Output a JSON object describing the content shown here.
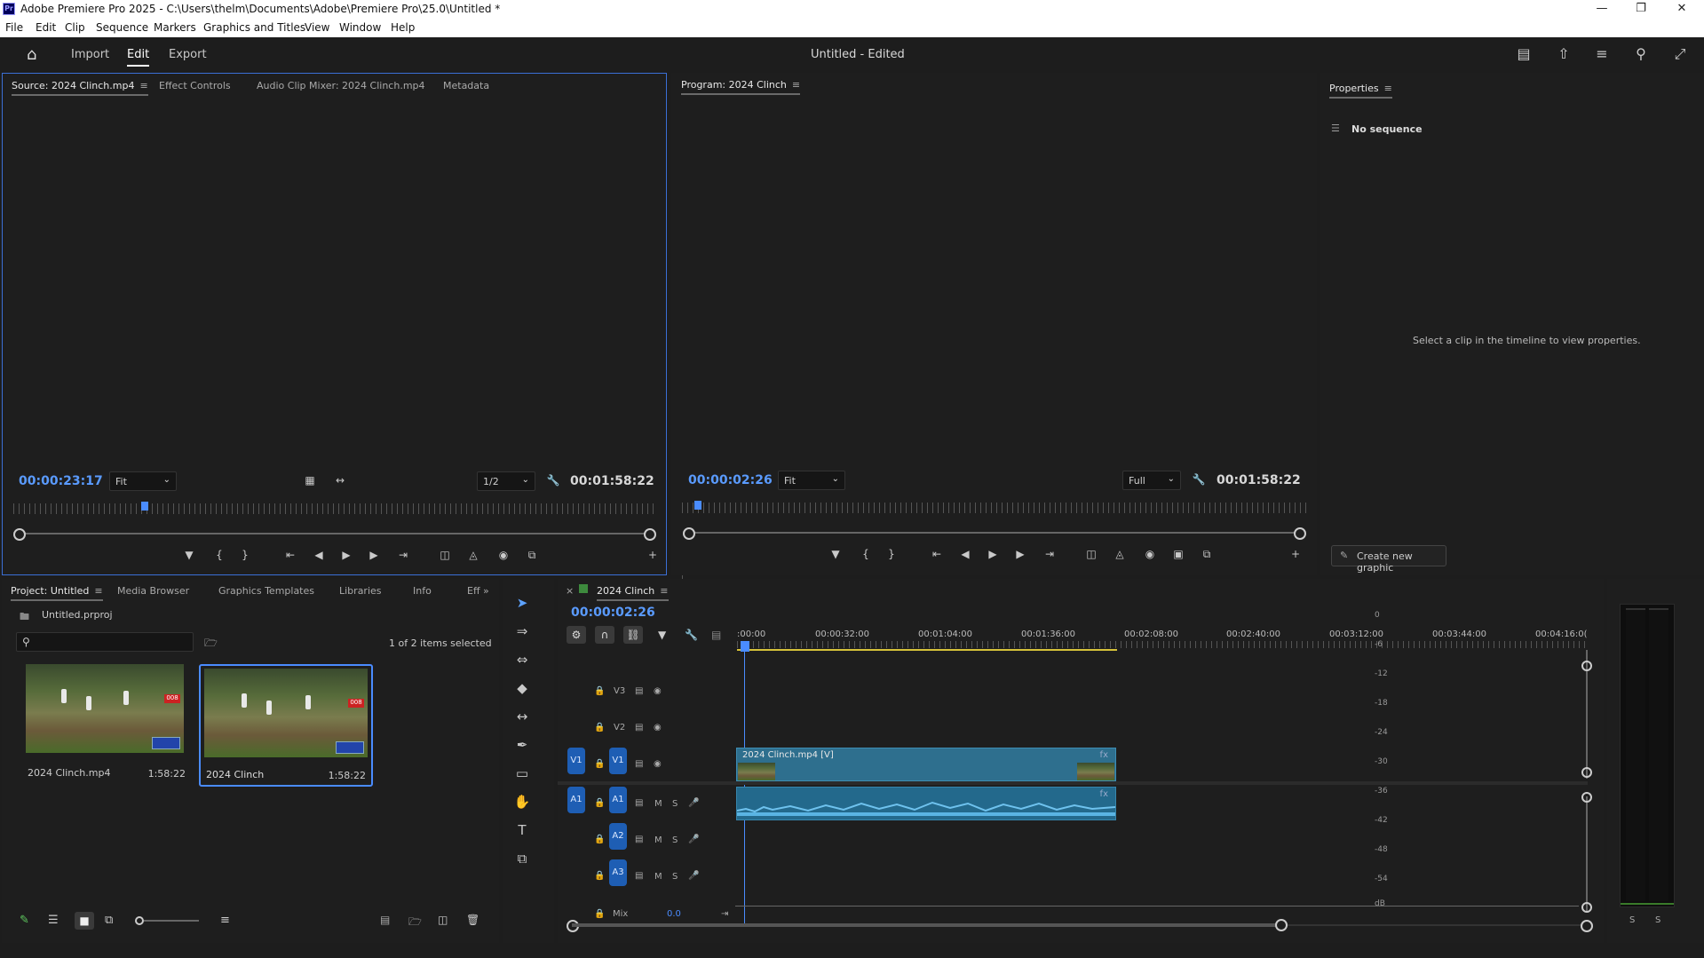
{
  "window": {
    "app_icon": "Pr",
    "title": "Adobe Premiere Pro 2025 - C:\\Users\\thelm\\Documents\\Adobe\\Premiere Pro\\25.0\\Untitled *",
    "controls": [
      "minimize-icon",
      "restore-icon",
      "close-icon"
    ]
  },
  "menu": [
    "File",
    "Edit",
    "Clip",
    "Sequence",
    "Markers",
    "Graphics and Titles",
    "View",
    "Window",
    "Help"
  ],
  "header": {
    "workspaces": [
      "Import",
      "Edit",
      "Export"
    ],
    "active_workspace": "Edit",
    "document_title": "Untitled - Edited"
  },
  "source_monitor": {
    "tabs": [
      "Source: 2024 Clinch.mp4",
      "Effect Controls",
      "Audio Clip Mixer: 2024 Clinch.mp4",
      "Metadata"
    ],
    "timecode": "00:00:23:17",
    "fit": "Fit",
    "resolution": "1/2",
    "duration": "00:01:58:22",
    "playhead_fraction": 0.198
  },
  "program_monitor": {
    "tab": "Program: 2024 Clinch",
    "timecode": "00:00:02:26",
    "fit": "Fit",
    "resolution": "Full",
    "duration": "00:01:58:22",
    "playhead_fraction": 0.02
  },
  "properties": {
    "tab": "Properties",
    "no_sequence": "No sequence",
    "hint": "Select a clip in the timeline to view properties.",
    "create_button": "Create new graphic"
  },
  "project": {
    "tabs": [
      "Project: Untitled",
      "Media Browser",
      "Graphics Templates",
      "Libraries",
      "Info",
      "Eff"
    ],
    "file": "Untitled.prproj",
    "search_placeholder": "",
    "selection": "1 of 2 items selected",
    "items": [
      {
        "name": "2024 Clinch.mp4",
        "duration": "1:58:22",
        "selected": false
      },
      {
        "name": "2024 Clinch",
        "duration": "1:58:22",
        "selected": true
      }
    ]
  },
  "timeline": {
    "sequence": "2024 Clinch",
    "timecode": "00:00:02:26",
    "ruler": [
      ":00:00",
      "00:00:32:00",
      "00:01:04:00",
      "00:01:36:00",
      "00:02:08:00",
      "00:02:40:00",
      "00:03:12:00",
      "00:03:44:00",
      "00:04:16:0("
    ],
    "video_tracks": [
      "V3",
      "V2",
      "V1"
    ],
    "audio_tracks": [
      "A1",
      "A2",
      "A3"
    ],
    "source_patch": {
      "video": "V1",
      "audio": "A1"
    },
    "mute_label": "M",
    "solo_label": "S",
    "mix_label": "Mix",
    "mix_value": "0.0",
    "clip_label": "2024 Clinch.mp4 [V]",
    "fx_label": "fx"
  },
  "meters": {
    "scale": [
      "0",
      "-6",
      "-12",
      "-18",
      "-24",
      "-30",
      "-36",
      "-42",
      "-48",
      "-54",
      "dB"
    ],
    "solo": [
      "S",
      "S"
    ]
  }
}
